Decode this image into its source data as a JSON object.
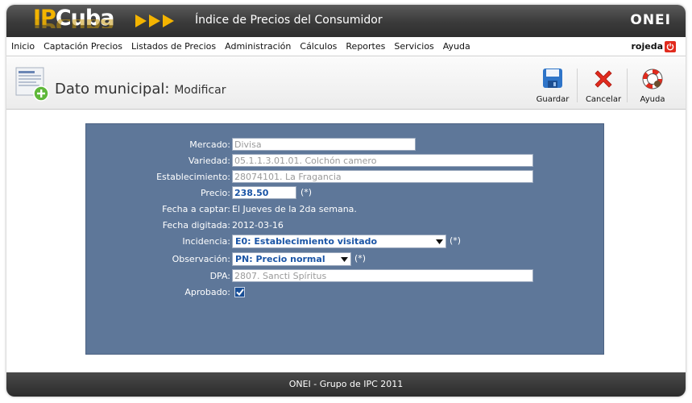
{
  "app": {
    "logo_ip": "IP",
    "logo_cuba": "Cuba",
    "banner_title": "Índice de Precios del Consumidor",
    "org_logo": "ONEI"
  },
  "menu": {
    "items": [
      "Inicio",
      "Captación Precios",
      "Listados de Precios",
      "Administración",
      "Cálculos",
      "Reportes",
      "Servicios",
      "Ayuda"
    ],
    "user": "rojeda"
  },
  "header": {
    "title": "Dato municipal:",
    "subtitle": "Modificar",
    "buttons": {
      "save": "Guardar",
      "cancel": "Cancelar",
      "help": "Ayuda"
    }
  },
  "form": {
    "mercado": {
      "label": "Mercado:",
      "value": "Divisa"
    },
    "variedad": {
      "label": "Variedad:",
      "value": "05.1.1.3.01.01. Colchón camero"
    },
    "establecimiento": {
      "label": "Establecimiento:",
      "value": "28074101. La Fragancia"
    },
    "precio": {
      "label": "Precio:",
      "value": "238.50",
      "required": "(*)"
    },
    "fecha_captar": {
      "label": "Fecha a captar:",
      "value": "El Jueves de la 2da semana."
    },
    "fecha_digitada": {
      "label": "Fecha digitada:",
      "value": "2012-03-16"
    },
    "incidencia": {
      "label": "Incidencia:",
      "value": "E0: Establecimiento visitado",
      "required": "(*)"
    },
    "observacion": {
      "label": "Observación:",
      "value": "PN: Precio normal",
      "required": "(*)"
    },
    "dpa": {
      "label": "DPA:",
      "value": "2807. Sancti Spíritus"
    },
    "aprobado": {
      "label": "Aprobado:",
      "checked": true
    }
  },
  "footer": {
    "text": "ONEI - Grupo de IPC 2011"
  },
  "colors": {
    "panel": "#5e7799",
    "accent_yellow": "#f4b400",
    "field_text": "#1b55a6",
    "cancel_red": "#e12b1e"
  },
  "icons": {
    "save": "floppy-disk-icon",
    "cancel": "red-x-icon",
    "help": "lifebuoy-icon",
    "power": "power-icon",
    "doc": "document-add-icon"
  }
}
